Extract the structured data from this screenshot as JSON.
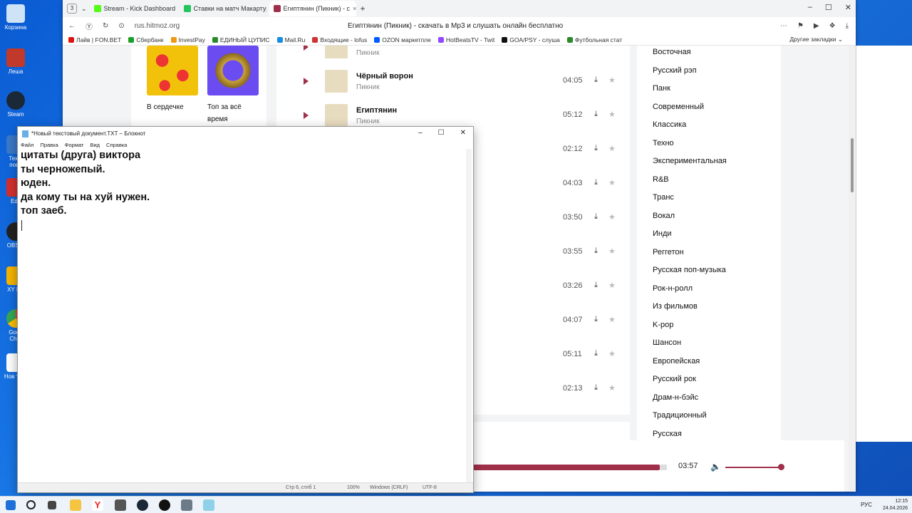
{
  "desktop": {
    "icons": [
      "Корзина",
      "Леша",
      "Steam",
      "Техн. пове",
      "Edit",
      "OBS S",
      "XY Fol",
      "Goog Chro",
      "Нов текс"
    ]
  },
  "browser": {
    "tab_count": "3",
    "tabs": [
      {
        "label": "Stream - Kick Dashboard",
        "color": "#53fc18"
      },
      {
        "label": "Ставки на матч Макартур",
        "color": "#22c55e"
      },
      {
        "label": "Египтянин (Пикник) - с",
        "color": "#a0304a"
      }
    ],
    "new_tab": "+",
    "url": "rus.hitmoz.org",
    "page_title": "Египтянин (Пикник) - скачать в Mp3 и слушать онлайн бесплатно",
    "bookmarks": [
      {
        "label": "Лайв | FON.BET",
        "color": "#d11"
      },
      {
        "label": "Сбербанк",
        "color": "#1a9f29"
      },
      {
        "label": "InvestPay",
        "color": "#e91"
      },
      {
        "label": "ЕДИНЫЙ ЦУПИС",
        "color": "#2a8a2a"
      },
      {
        "label": "Mail.Ru",
        "color": "#168de2"
      },
      {
        "label": "Входящие - lofus",
        "color": "#c33"
      },
      {
        "label": "OZON маркетпле",
        "color": "#005bff"
      },
      {
        "label": "HotBeatsTV - Twit",
        "color": "#9146ff"
      },
      {
        "label": "GOA/PSY - слуша",
        "color": "#111"
      },
      {
        "label": "Футбольная стат",
        "color": "#2a8a2a"
      }
    ],
    "bookmarks_other": "Другие закладки"
  },
  "site": {
    "collections": [
      {
        "label": "В сердечке"
      },
      {
        "label": "Топ за всё время"
      }
    ],
    "tracks": [
      {
        "title": "",
        "artist": "Пикник",
        "duration": ""
      },
      {
        "title": "Чёрный ворон",
        "artist": "Пикник",
        "duration": "04:05"
      },
      {
        "title": "Египтянин",
        "artist": "Пикник",
        "duration": "05:12"
      },
      {
        "title": "",
        "artist": "",
        "duration": "02:12"
      },
      {
        "title": "",
        "artist": "",
        "duration": "04:03"
      },
      {
        "title": "",
        "artist": "",
        "duration": "03:50"
      },
      {
        "title": "",
        "artist": "",
        "duration": "03:55"
      },
      {
        "title": "",
        "artist": "",
        "duration": "03:26"
      },
      {
        "title": "",
        "artist": "",
        "duration": "04:07"
      },
      {
        "title": "",
        "artist": "",
        "duration": "05:11"
      },
      {
        "title": "",
        "artist": "",
        "duration": "02:13"
      }
    ],
    "genres": [
      "Восточная",
      "Русский рэп",
      "Панк",
      "Современный",
      "Классика",
      "Техно",
      "Экспериментальная",
      "R&B",
      "Транс",
      "Вокал",
      "Инди",
      "Реггетон",
      "Русская поп-музыка",
      "Рок-н-ролл",
      "Из фильмов",
      "K-pop",
      "Шансон",
      "Европейская",
      "Русский рок",
      "Драм-н-бэйс",
      "Традиционный",
      "Русская"
    ],
    "player": {
      "time": "03:57",
      "progress": 0.96,
      "volume": 0.95
    }
  },
  "notepad": {
    "title": "*Новый текстовый документ.TXT – Блокнот",
    "menu": [
      "Файл",
      "Правка",
      "Формат",
      "Вид",
      "Справка"
    ],
    "lines": [
      "цитаты (друга) виктора",
      "ты черножепый.",
      "юден.",
      "да кому ты на хуй нужен.",
      "топ заеб."
    ],
    "status": [
      "Стр 6, стлб 1",
      "100%",
      "Windows (CRLF)",
      "UTF-8"
    ]
  },
  "taskbar": {
    "lang": "РУС",
    "time": "12:15",
    "date": "24.04.2026"
  }
}
